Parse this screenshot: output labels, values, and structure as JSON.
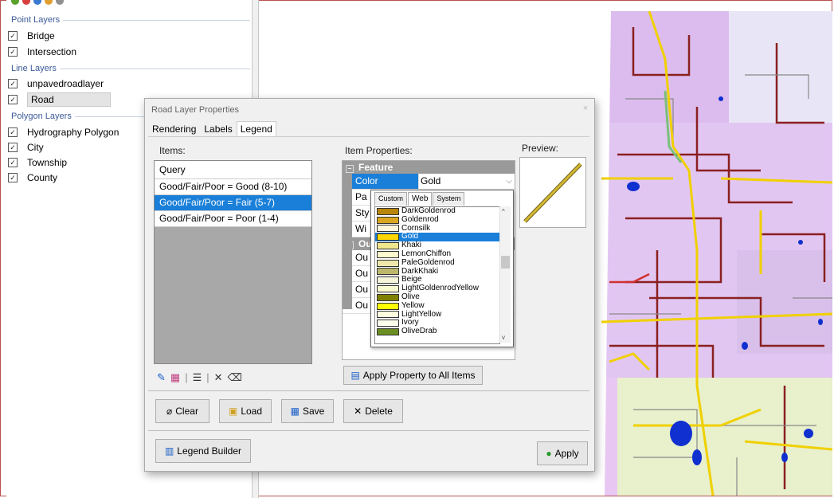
{
  "layers_panel": {
    "groups": [
      {
        "name": "Point Layers",
        "layers": [
          "Bridge",
          "Intersection"
        ]
      },
      {
        "name": "Line Layers",
        "layers": [
          "unpavedroadlayer",
          "Road"
        ]
      },
      {
        "name": "Polygon Layers",
        "layers": [
          "Hydrography Polygon",
          "City",
          "Township",
          "County"
        ]
      }
    ],
    "checkmark": "☑"
  },
  "dialog": {
    "title": "Road Layer Properties",
    "close": "×",
    "tabs": [
      "Rendering",
      "Labels",
      "Legend"
    ],
    "active_tab": "Legend",
    "items_label": "Items:",
    "item_properties_label": "Item Properties:",
    "preview_label": "Preview:",
    "items": [
      "Query",
      "Good/Fair/Poor = Good (8-10)",
      "Good/Fair/Poor = Fair (5-7)",
      "Good/Fair/Poor = Poor (1-4)"
    ],
    "selected_item": "Good/Fair/Poor = Fair (5-7)",
    "feature_category": "Feature",
    "outline_category_short": "Ou",
    "props": [
      {
        "name": "Color",
        "value": "Gold"
      },
      {
        "name": "Pa",
        "value": ""
      },
      {
        "name": "Sty",
        "value": ""
      },
      {
        "name": "Wi",
        "value": ""
      }
    ],
    "outline_props": [
      "Ou",
      "Ou",
      "Ou",
      "Ou"
    ],
    "color_dropdown": {
      "tabs": [
        "Custom",
        "Web",
        "System"
      ],
      "active_tab": "Web",
      "colors": [
        {
          "name": "DarkGoldenrod",
          "hex": "#B8860B"
        },
        {
          "name": "Goldenrod",
          "hex": "#DAA520"
        },
        {
          "name": "Cornsilk",
          "hex": "#FFF8DC"
        },
        {
          "name": "Gold",
          "hex": "#FFD700"
        },
        {
          "name": "Khaki",
          "hex": "#F0E68C"
        },
        {
          "name": "LemonChiffon",
          "hex": "#FFFACD"
        },
        {
          "name": "PaleGoldenrod",
          "hex": "#EEE8AA"
        },
        {
          "name": "DarkKhaki",
          "hex": "#BDB76B"
        },
        {
          "name": "Beige",
          "hex": "#F5F5DC"
        },
        {
          "name": "LightGoldenrodYellow",
          "hex": "#FAFAD2"
        },
        {
          "name": "Olive",
          "hex": "#808000"
        },
        {
          "name": "Yellow",
          "hex": "#FFFF00"
        },
        {
          "name": "LightYellow",
          "hex": "#FFFFE0"
        },
        {
          "name": "Ivory",
          "hex": "#FFFFF0"
        },
        {
          "name": "OliveDrab",
          "hex": "#6B8E23"
        }
      ],
      "selected": "Gold"
    },
    "apply_all_label": "Apply Property to All Items",
    "buttons": {
      "clear": "Clear",
      "load": "Load",
      "save": "Save",
      "delete": "Delete"
    },
    "legend_builder": "Legend Builder",
    "apply": "Apply",
    "preview_line_color": "#d4b830"
  }
}
